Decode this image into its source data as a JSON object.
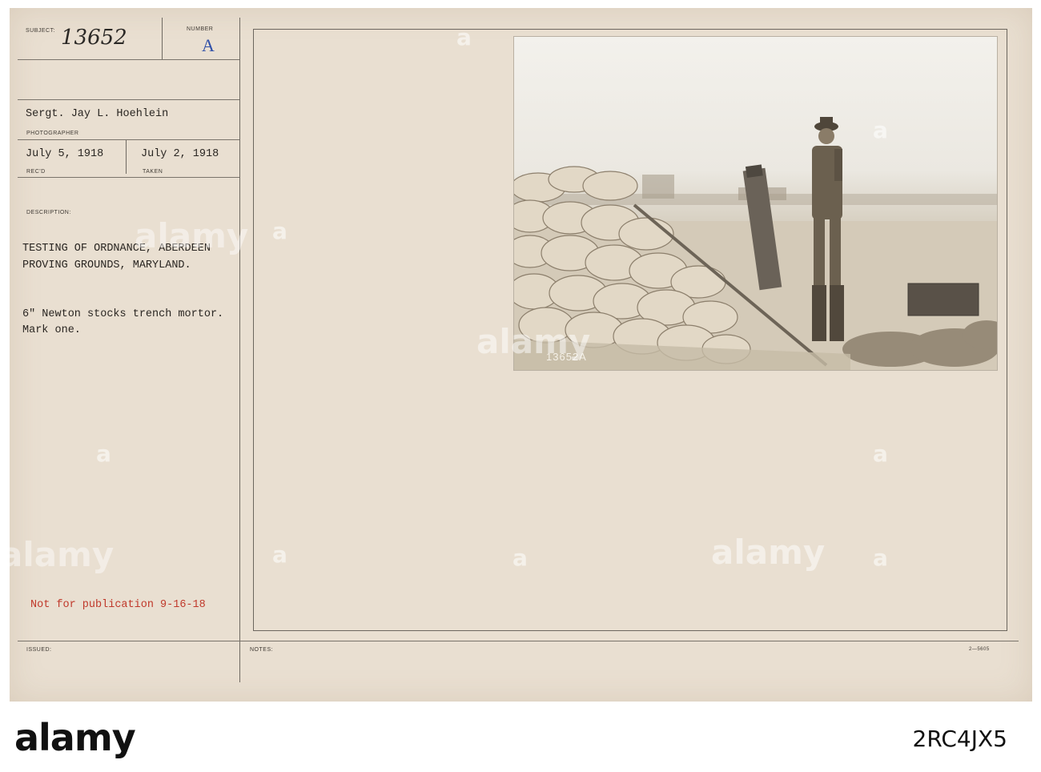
{
  "record": {
    "subject_label": "SUBJECT:",
    "subject_number": "13652",
    "number_label": "NUMBER",
    "number_value": "A",
    "photographer": "Sergt. Jay L. Hoehlein",
    "photographer_label": "PHOTOGRAPHER",
    "received_date": "July 5, 1918",
    "received_label": "REC'D",
    "taken_date": "July 2, 1918",
    "taken_label": "TAKEN",
    "description_label": "DESCRIPTION:",
    "description_line1": "TESTING OF ORDNANCE, ABERDEEN",
    "description_line2": "PROVING GROUNDS, MARYLAND.",
    "caption_line1": "6\" Newton stocks trench mortor.",
    "caption_line2": "Mark one.",
    "stamp": "Not for publication 9-16-18",
    "issued_label": "ISSUED:",
    "notes_label": "NOTES:",
    "form_number": "2—5605"
  },
  "photo": {
    "negative_number": "13652A"
  },
  "watermark": {
    "text": "alamy",
    "icon": "a"
  },
  "footer": {
    "brand": "alamy",
    "stock_id": "2RC4JX5"
  },
  "colors": {
    "card": "#e9dfd1",
    "stamp_red": "#c0392b",
    "number_blue": "#2f4fa8"
  }
}
